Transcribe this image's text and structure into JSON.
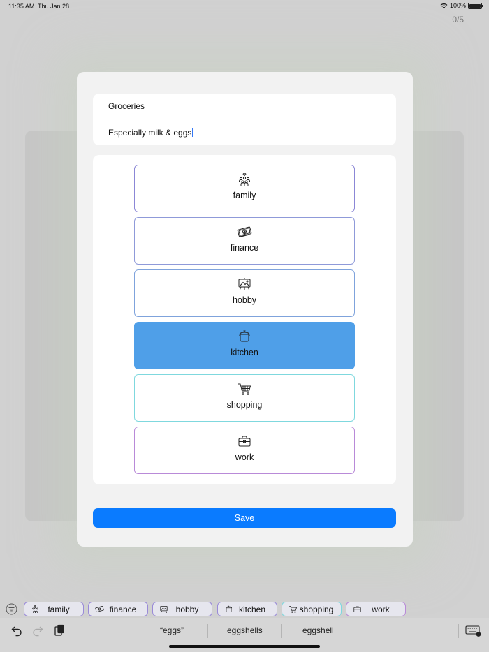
{
  "status": {
    "time": "11:35 AM",
    "date": "Thu Jan 28",
    "battery": "100%"
  },
  "counter": "0/5",
  "form": {
    "title_value": "Groceries",
    "notes_value": "Especially milk & eggs"
  },
  "categories": [
    {
      "label": "family",
      "icon": "family-icon",
      "color": "#8b87d6"
    },
    {
      "label": "finance",
      "icon": "money-icon",
      "color": "#8f9ad9"
    },
    {
      "label": "hobby",
      "icon": "easel-icon",
      "color": "#7fa3dc"
    },
    {
      "label": "kitchen",
      "icon": "pot-icon",
      "color": "#4f9fe8",
      "selected": true
    },
    {
      "label": "shopping",
      "icon": "cart-icon",
      "color": "#7fd8de"
    },
    {
      "label": "work",
      "icon": "briefcase-icon",
      "color": "#b98ad8"
    }
  ],
  "save_label": "Save",
  "tags": [
    "family",
    "finance",
    "hobby",
    "kitchen",
    "shopping",
    "work"
  ],
  "suggestions": [
    "“eggs”",
    "eggshells",
    "eggshell"
  ]
}
